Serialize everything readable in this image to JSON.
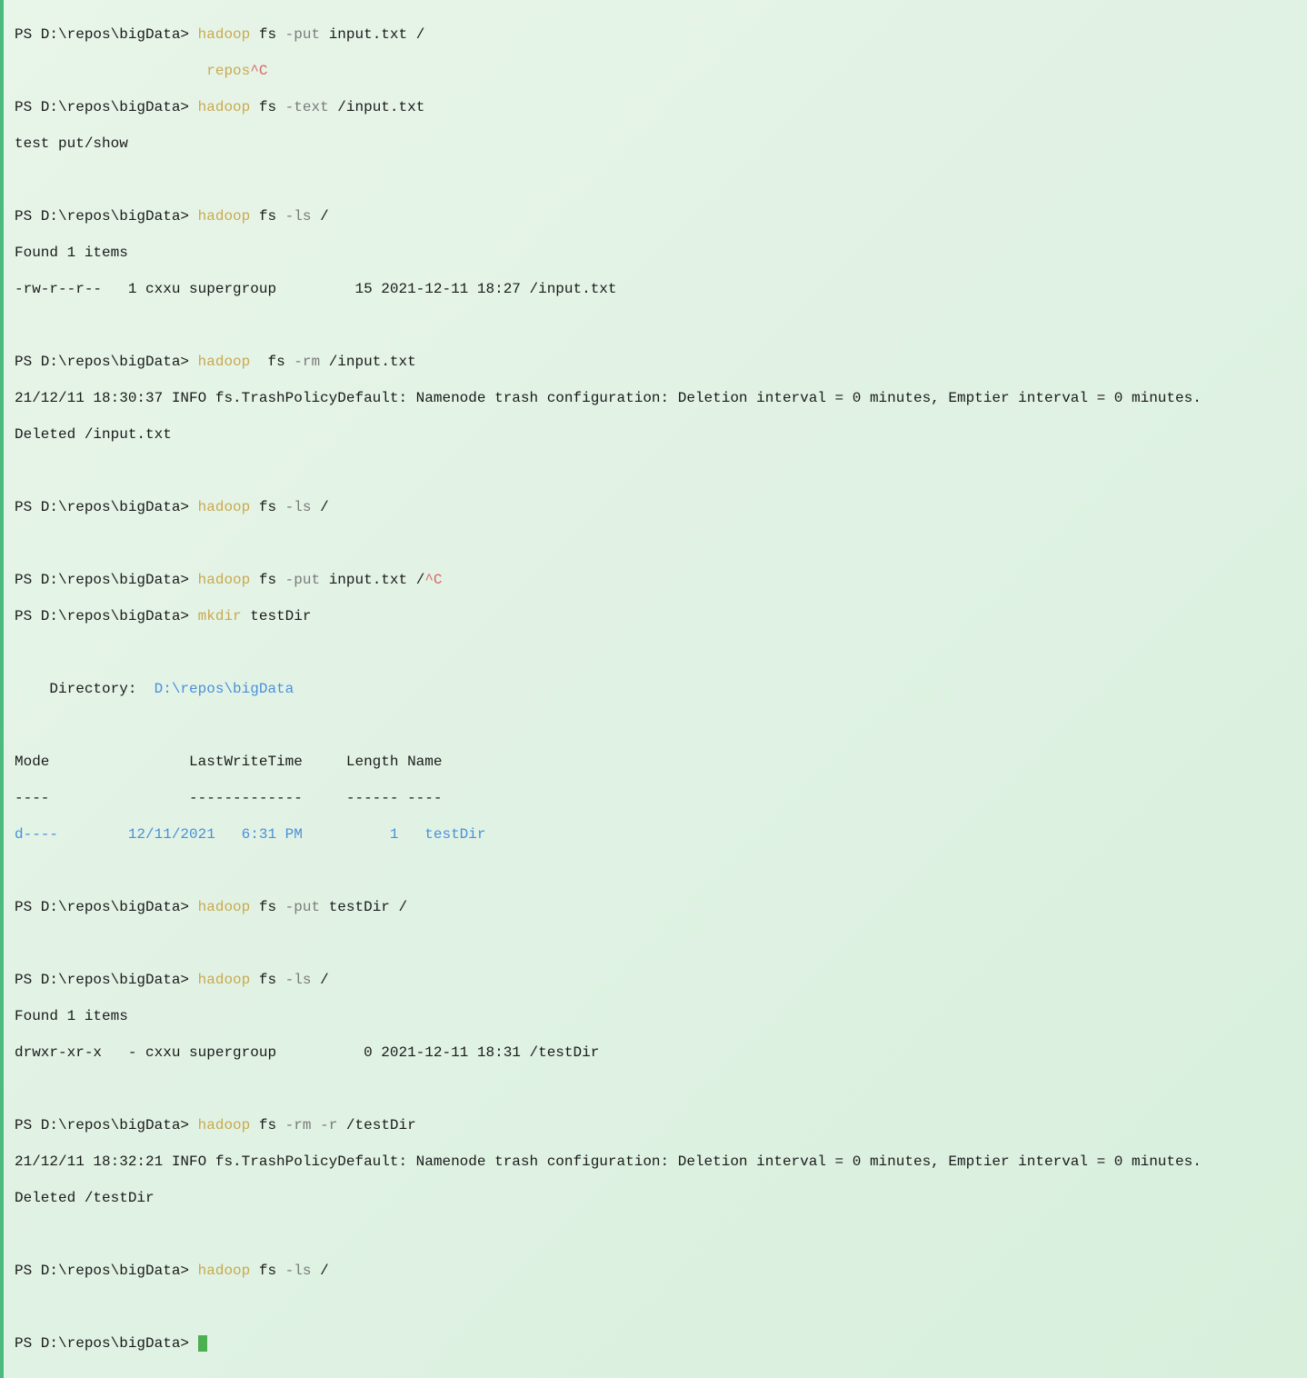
{
  "prompt": "PS D:\\repos\\bigData>",
  "lines": {
    "l1": {
      "cmd": "hadoop",
      "fs": "fs",
      "flag": "-put",
      "arg": "input.txt /"
    },
    "l2": {
      "repos": "repos",
      "ctrlc": "^C"
    },
    "l3": {
      "cmd": "hadoop",
      "fs": "fs",
      "flag": "-text",
      "arg": "/input.txt"
    },
    "l4": "test put/show",
    "l5": {
      "cmd": "hadoop",
      "fs": "fs",
      "flag": "-ls",
      "arg": "/"
    },
    "l6": "Found 1 items",
    "l7": "-rw-r--r--   1 cxxu supergroup         15 2021-12-11 18:27 /input.txt",
    "l8": {
      "cmd": "hadoop",
      "fs": " fs",
      "flag": "-rm",
      "arg": "/input.txt"
    },
    "l9": "21/12/11 18:30:37 INFO fs.TrashPolicyDefault: Namenode trash configuration: Deletion interval = 0 minutes, Emptier interval = 0 minutes.",
    "l10": "Deleted /input.txt",
    "l11": {
      "cmd": "hadoop",
      "fs": "fs",
      "flag": "-ls",
      "arg": "/"
    },
    "l12": {
      "cmd": "hadoop",
      "fs": "fs",
      "flag": "-put",
      "arg": "input.txt /",
      "ctrlc": "^C"
    },
    "l13": {
      "cmd": "mkdir",
      "arg": "testDir"
    },
    "l14": {
      "label": "    Directory:  ",
      "path": "D:\\repos\\bigData"
    },
    "l15": "Mode                LastWriteTime     Length Name",
    "l16": "----                -------------     ------ ----",
    "l17": "d----        12/11/2021   6:31 PM          1   testDir",
    "l18": {
      "cmd": "hadoop",
      "fs": "fs",
      "flag": "-put",
      "arg": "testDir /"
    },
    "l19": {
      "cmd": "hadoop",
      "fs": "fs",
      "flag": "-ls",
      "arg": "/"
    },
    "l20": "Found 1 items",
    "l21": "drwxr-xr-x   - cxxu supergroup          0 2021-12-11 18:31 /testDir",
    "l22": {
      "cmd": "hadoop",
      "fs": "fs",
      "flag": "-rm",
      "flag2": "-r",
      "arg": "/testDir"
    },
    "l23": "21/12/11 18:32:21 INFO fs.TrashPolicyDefault: Namenode trash configuration: Deletion interval = 0 minutes, Emptier interval = 0 minutes.",
    "l24": "Deleted /testDir",
    "l25": {
      "cmd": "hadoop",
      "fs": "fs",
      "flag": "-ls",
      "arg": "/"
    }
  }
}
